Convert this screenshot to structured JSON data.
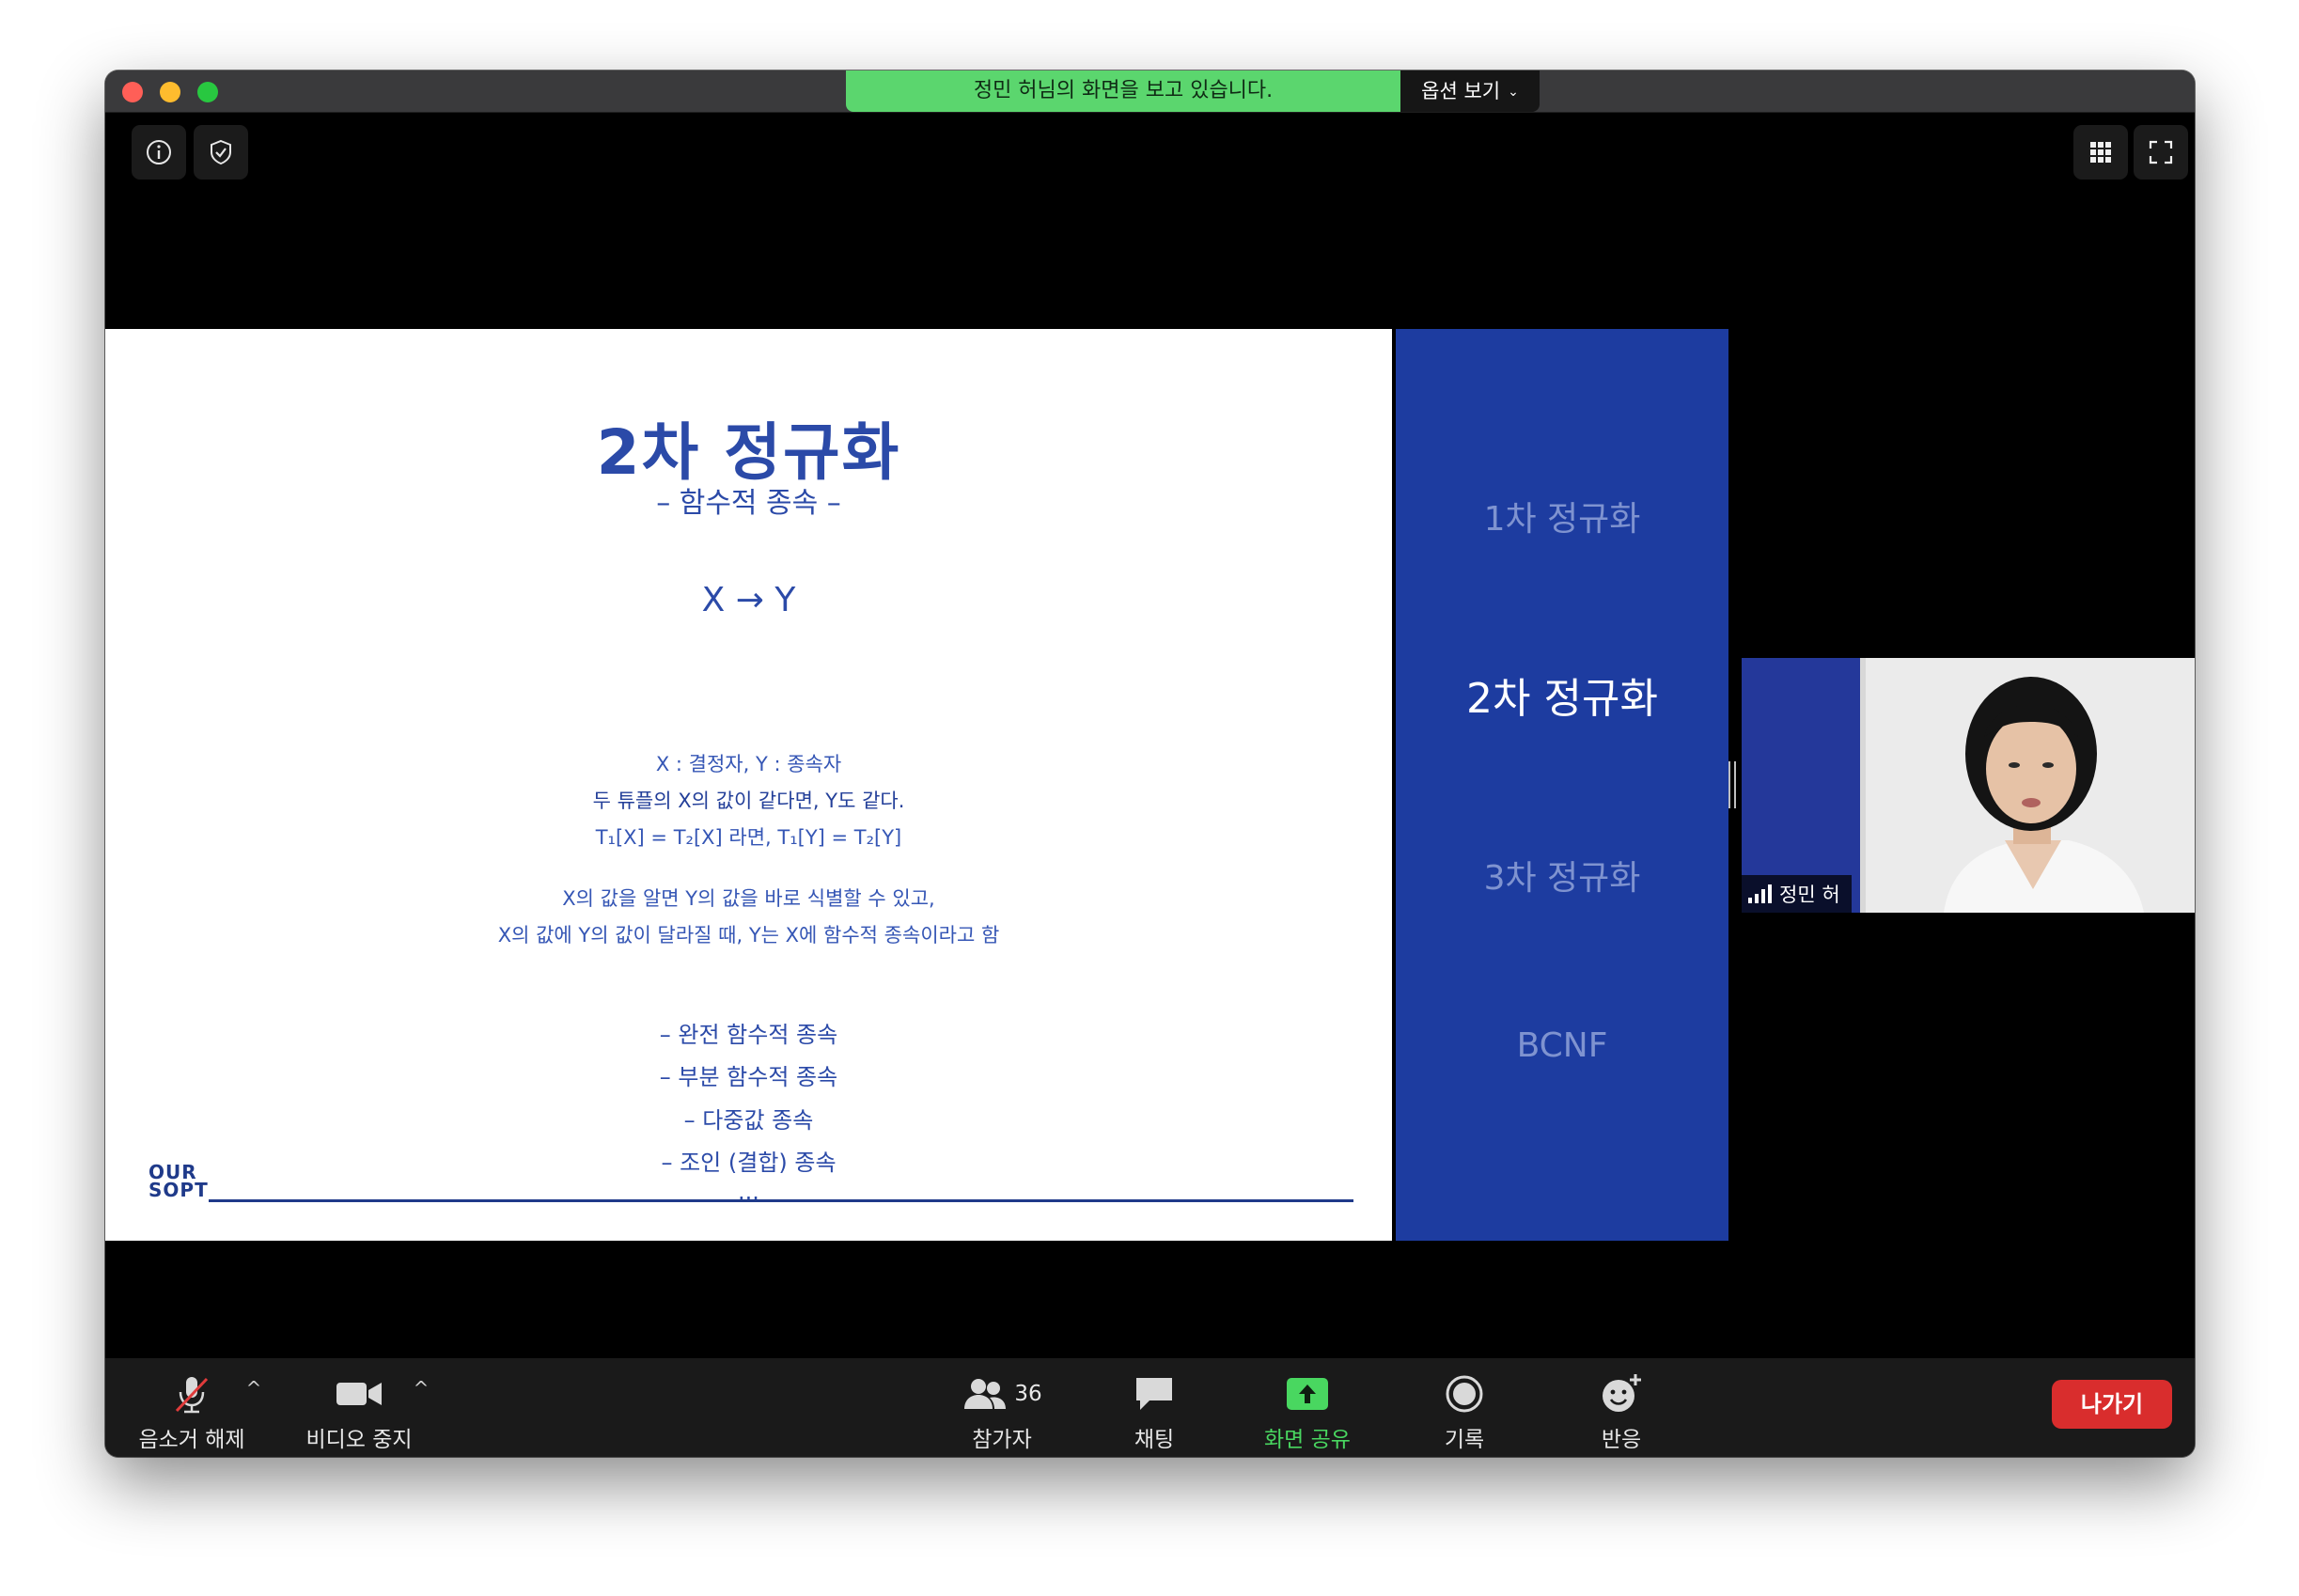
{
  "window": {
    "share_banner": "정민 허님의 화면을 보고 있습니다.",
    "view_options": "옵션 보기"
  },
  "slide": {
    "title": "2차 정규화",
    "subtitle": "– 함수적 종속 –",
    "formula": "X → Y",
    "lines": [
      "X : 결정자, Y : 종속자",
      "두 튜플의 X의 값이 같다면, Y도 같다.",
      "T₁[X] = T₂[X] 라면, T₁[Y] = T₂[Y]",
      "X의 값을 알면 Y의 값을 바로 식별할 수 있고,",
      "X의 값에 Y의 값이 달라질 때, Y는 X에 함수적 종속이라고 함"
    ],
    "list": [
      "– 완전 함수적 종속",
      "– 부분 함수적 종속",
      "– 다중값 종속",
      "– 조인 (결합) 종속",
      "..."
    ],
    "logo_line1": "OUR",
    "logo_line2": "SOPT"
  },
  "sidebar": {
    "items": [
      "1차 정규화",
      "2차 정규화",
      "3차 정규화",
      "BCNF"
    ],
    "active_index": 1
  },
  "participant": {
    "name": "정민 허"
  },
  "toolbar": {
    "mute_label": "음소거 해제",
    "video_label": "비디오 중지",
    "participants_label": "참가자",
    "participants_count": "36",
    "chat_label": "채팅",
    "share_label": "화면 공유",
    "record_label": "기록",
    "reactions_label": "반응",
    "leave_label": "나가기"
  },
  "colors": {
    "share_green": "#5bd66e",
    "slide_blue": "#2b4aa8",
    "sidebar_blue": "#1d3ca0",
    "leave_red": "#d92d2d"
  }
}
